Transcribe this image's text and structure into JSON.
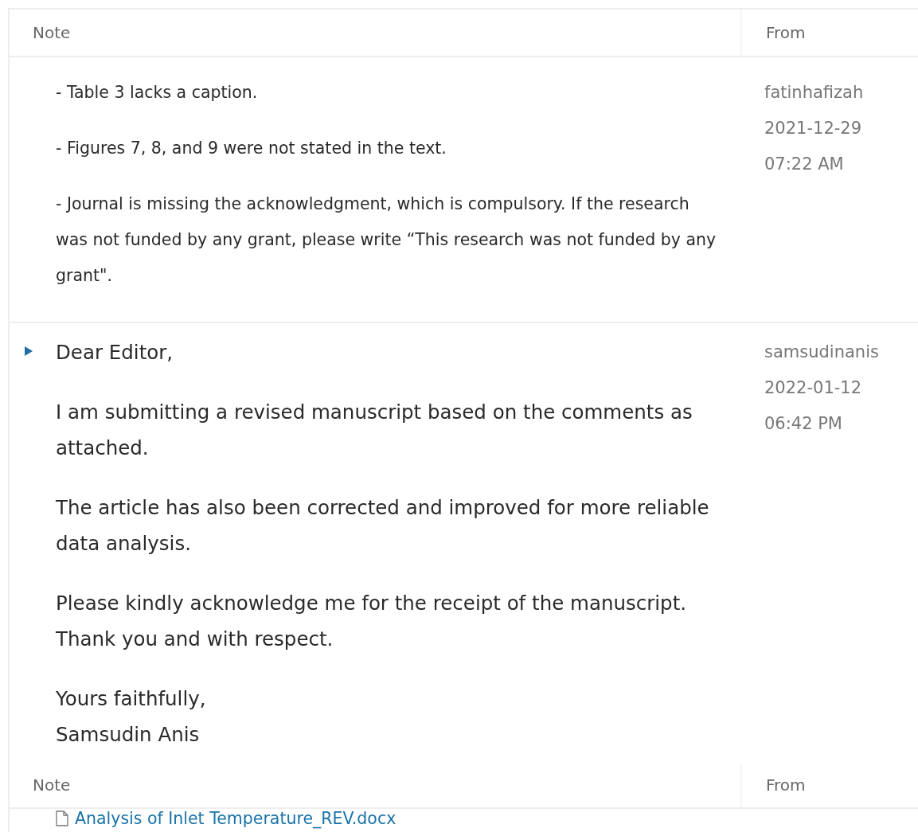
{
  "table": {
    "columns": [
      "Note",
      "From"
    ],
    "rows": [
      {
        "expanded": null,
        "paragraphs": [
          "- Table 3 lacks a caption.",
          "- Figures 7, 8, and 9 were not stated in the text.",
          "- Journal is missing the acknowledgment, which is compulsory. If the research was not funded by any grant, please write “This research was not funded by any grant\"."
        ],
        "from": {
          "user": "fatinhafizah",
          "date": "2021-12-29",
          "time": "07:22 AM"
        }
      },
      {
        "expanded": false,
        "paragraphs": [
          "Dear Editor,",
          "I am submitting a revised manuscript based on the comments as attached.",
          "The article has also been corrected and improved for more reliable data analysis.",
          "Please kindly acknowledge me for the receipt of the manuscript.\nThank you and with respect.",
          "Yours faithfully,\nSamsudin Anis"
        ],
        "from": {
          "user": "samsudinanis",
          "date": "2022-01-12",
          "time": "06:42 PM"
        }
      }
    ],
    "footer_columns": [
      "Note",
      "From"
    ],
    "attachment": "Analysis of Inlet Temperature_REV.docx"
  }
}
